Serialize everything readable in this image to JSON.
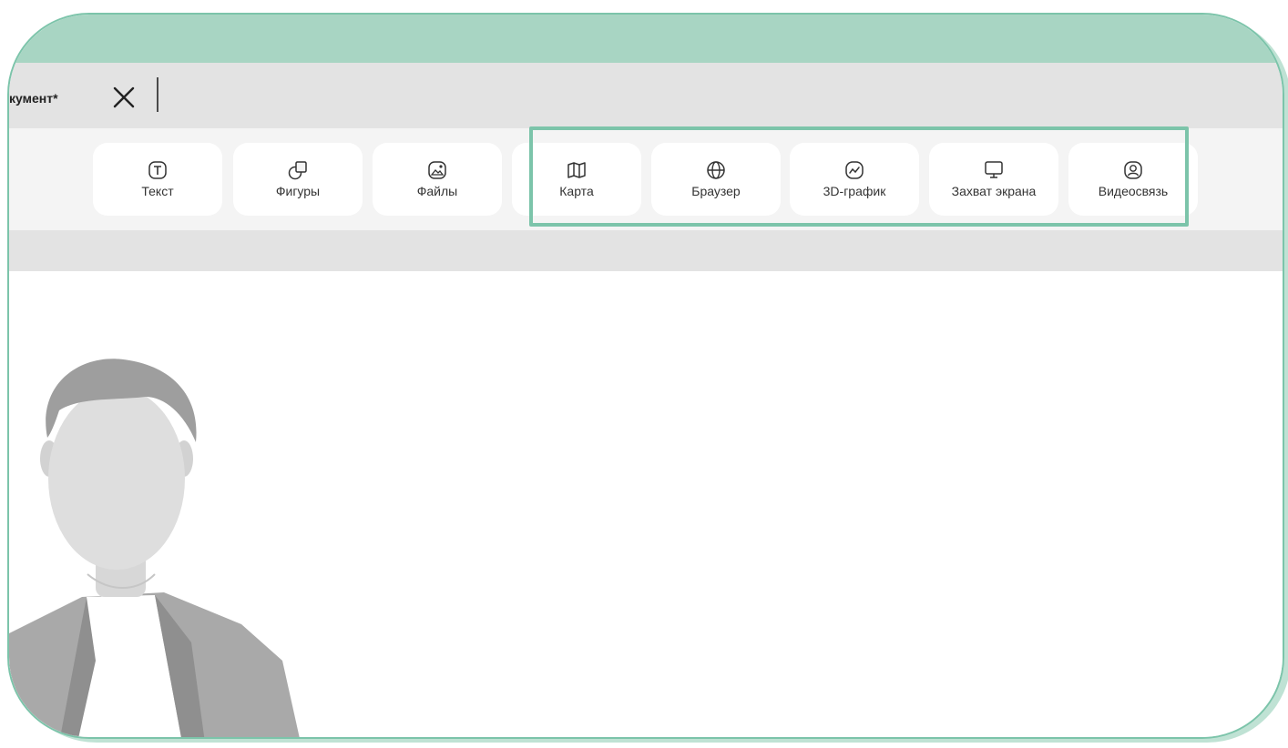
{
  "document": {
    "title": "кумент*"
  },
  "toolbar": {
    "tools": [
      {
        "label": "Текст",
        "icon": "text-icon"
      },
      {
        "label": "Фигуры",
        "icon": "shapes-icon"
      },
      {
        "label": "Файлы",
        "icon": "image-icon"
      },
      {
        "label": "Карта",
        "icon": "map-icon"
      },
      {
        "label": "Браузер",
        "icon": "globe-icon"
      },
      {
        "label": "3D-график",
        "icon": "chart-icon"
      },
      {
        "label": "Захват экрана",
        "icon": "monitor-icon"
      },
      {
        "label": "Видеосвязь",
        "icon": "user-circle-icon"
      }
    ]
  },
  "colors": {
    "accent": "#7cc4aa",
    "header_band": "#a8d5c3",
    "tab_bar": "#e3e3e3",
    "toolbar_bg": "#f4f4f4"
  }
}
